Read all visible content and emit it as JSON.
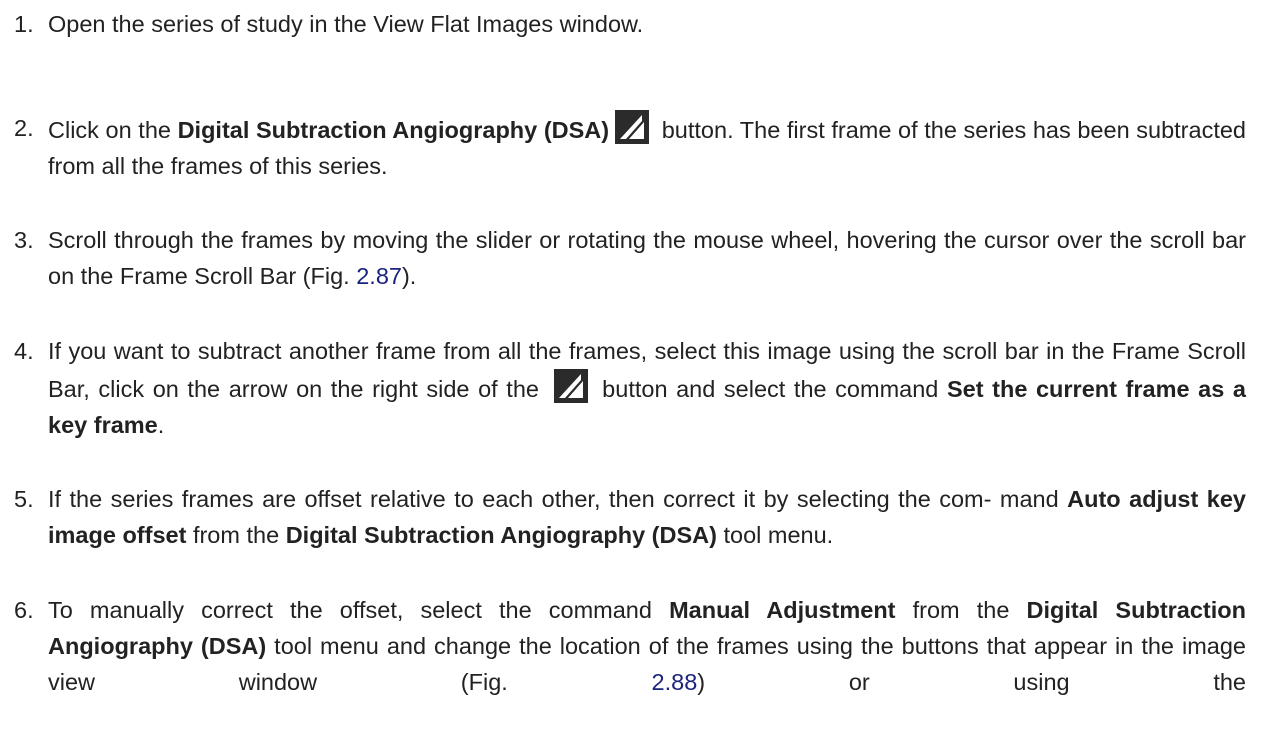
{
  "steps": [
    {
      "number": "1.",
      "text": "Open the series of study in the View Flat Images window."
    },
    {
      "number": "2.",
      "pre": "Click on the ",
      "bold1": "Digital Subtraction Angiography (DSA)",
      "post": " button. The first frame of the series has been subtracted from all the frames of this series."
    },
    {
      "number": "3.",
      "pre": "Scroll through the frames by moving the slider or rotating the mouse wheel, hovering the cursor over the scroll bar on the Frame Scroll Bar (Fig. ",
      "link": "2.87",
      "post": ")."
    },
    {
      "number": "4.",
      "pre": "If you want to subtract another frame from all the frames, select this image using the scroll bar in the Frame Scroll Bar, click on the arrow on the right side of the ",
      "mid": " button and select the command ",
      "bold1": "Set the current frame as a key frame",
      "post": "."
    },
    {
      "number": "5.",
      "pre": "If the series frames are offset relative to each other, then correct it by selecting the com- mand ",
      "bold1": "Auto adjust key image offset",
      "mid": " from the ",
      "bold2": "Digital Subtraction Angiography (DSA)",
      "post": " tool menu."
    },
    {
      "number": "6.",
      "pre": "To manually correct the offset, select the command ",
      "bold1": "Manual Adjustment",
      "mid": " from the ",
      "bold2": "Digital Subtraction Angiography (DSA)",
      "mid2": " tool menu and change the location of the frames using the buttons that appear in the image view window (Fig. ",
      "link": "2.88",
      "post": ") or using the"
    }
  ],
  "icons": {
    "dsa": "dsa-subtraction-icon"
  },
  "colors": {
    "text": "#222222",
    "link": "#1a237e"
  }
}
